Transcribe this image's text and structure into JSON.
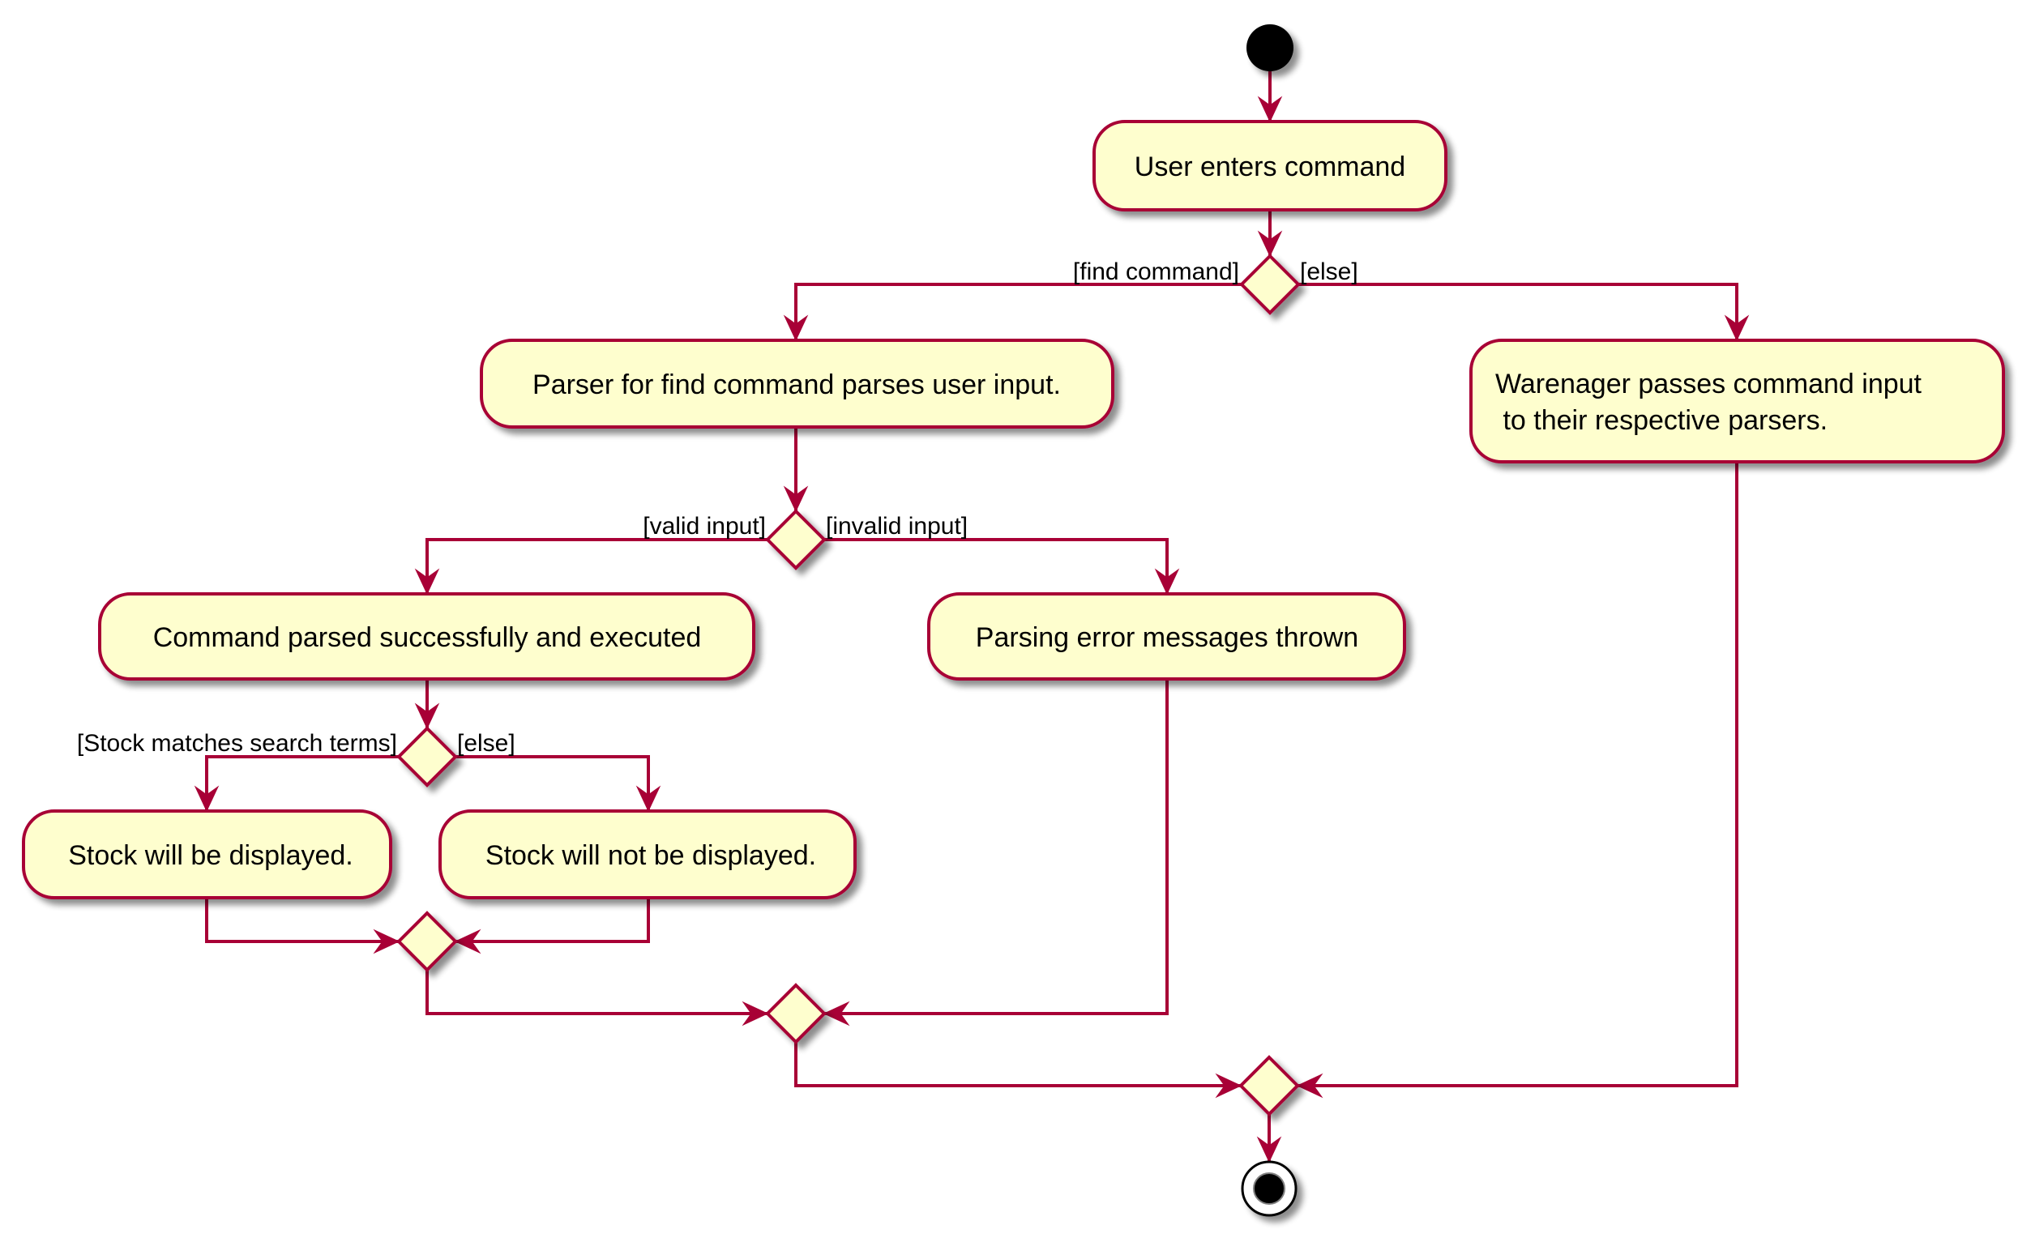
{
  "diagram": {
    "type": "activity",
    "colors": {
      "line": "#A80036",
      "fill": "#FEFECE",
      "text": "#000000",
      "start": "#000000"
    },
    "nodes": {
      "start": {
        "kind": "start"
      },
      "user_enters": {
        "kind": "action",
        "lines": [
          "User enters command"
        ]
      },
      "decision_command": {
        "kind": "decision",
        "yes": "[find command]",
        "no": "[else]"
      },
      "parser_find": {
        "kind": "action",
        "lines": [
          "Parser for find command parses user input."
        ]
      },
      "warenager_passes": {
        "kind": "action",
        "lines": [
          "Warenager passes command input",
          " to their respective parsers."
        ]
      },
      "decision_input": {
        "kind": "decision",
        "yes": "[valid input]",
        "no": "[invalid input]"
      },
      "command_parsed": {
        "kind": "action",
        "lines": [
          "Command parsed successfully and executed"
        ]
      },
      "parsing_error": {
        "kind": "action",
        "lines": [
          "Parsing error messages thrown"
        ]
      },
      "decision_match": {
        "kind": "decision",
        "yes": "[Stock matches search terms]",
        "no": "[else]"
      },
      "stock_displayed": {
        "kind": "action",
        "lines": [
          "Stock will be displayed."
        ]
      },
      "stock_not_displayed": {
        "kind": "action",
        "lines": [
          "Stock will not be displayed."
        ]
      },
      "merge_match": {
        "kind": "merge"
      },
      "merge_input": {
        "kind": "merge"
      },
      "merge_command": {
        "kind": "merge"
      },
      "end": {
        "kind": "end"
      }
    }
  }
}
